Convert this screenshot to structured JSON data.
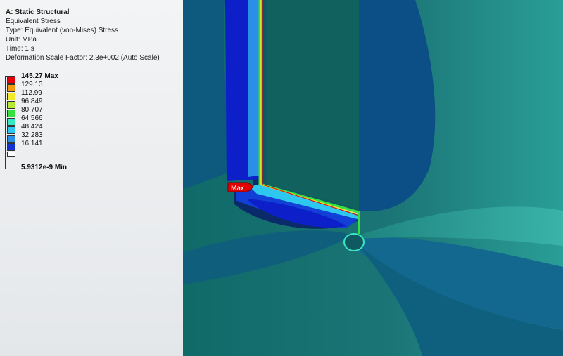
{
  "analysis": {
    "title": "A: Static Structural",
    "result": "Equivalent Stress",
    "type_line": "Type: Equivalent (von-Mises) Stress",
    "unit_line": "Unit: MPa",
    "time_line": "Time: 1 s",
    "scale_line": "Deformation Scale Factor: 2.3e+002 (Auto Scale)"
  },
  "legend": {
    "max_label": "145.27 Max",
    "min_label": "5.9312e-9 Min",
    "levels": [
      "129.13",
      "112.99",
      "96.849",
      "80.707",
      "64.566",
      "48.424",
      "32.283",
      "16.141"
    ],
    "colors": [
      "#e6000b",
      "#f39a0f",
      "#f2e92a",
      "#b6e836",
      "#36e03f",
      "#37e8c3",
      "#2ec7f0",
      "#2a8fe6",
      "#1233d0"
    ]
  },
  "probe": {
    "max_tag": "Max",
    "color": "#e00000"
  }
}
